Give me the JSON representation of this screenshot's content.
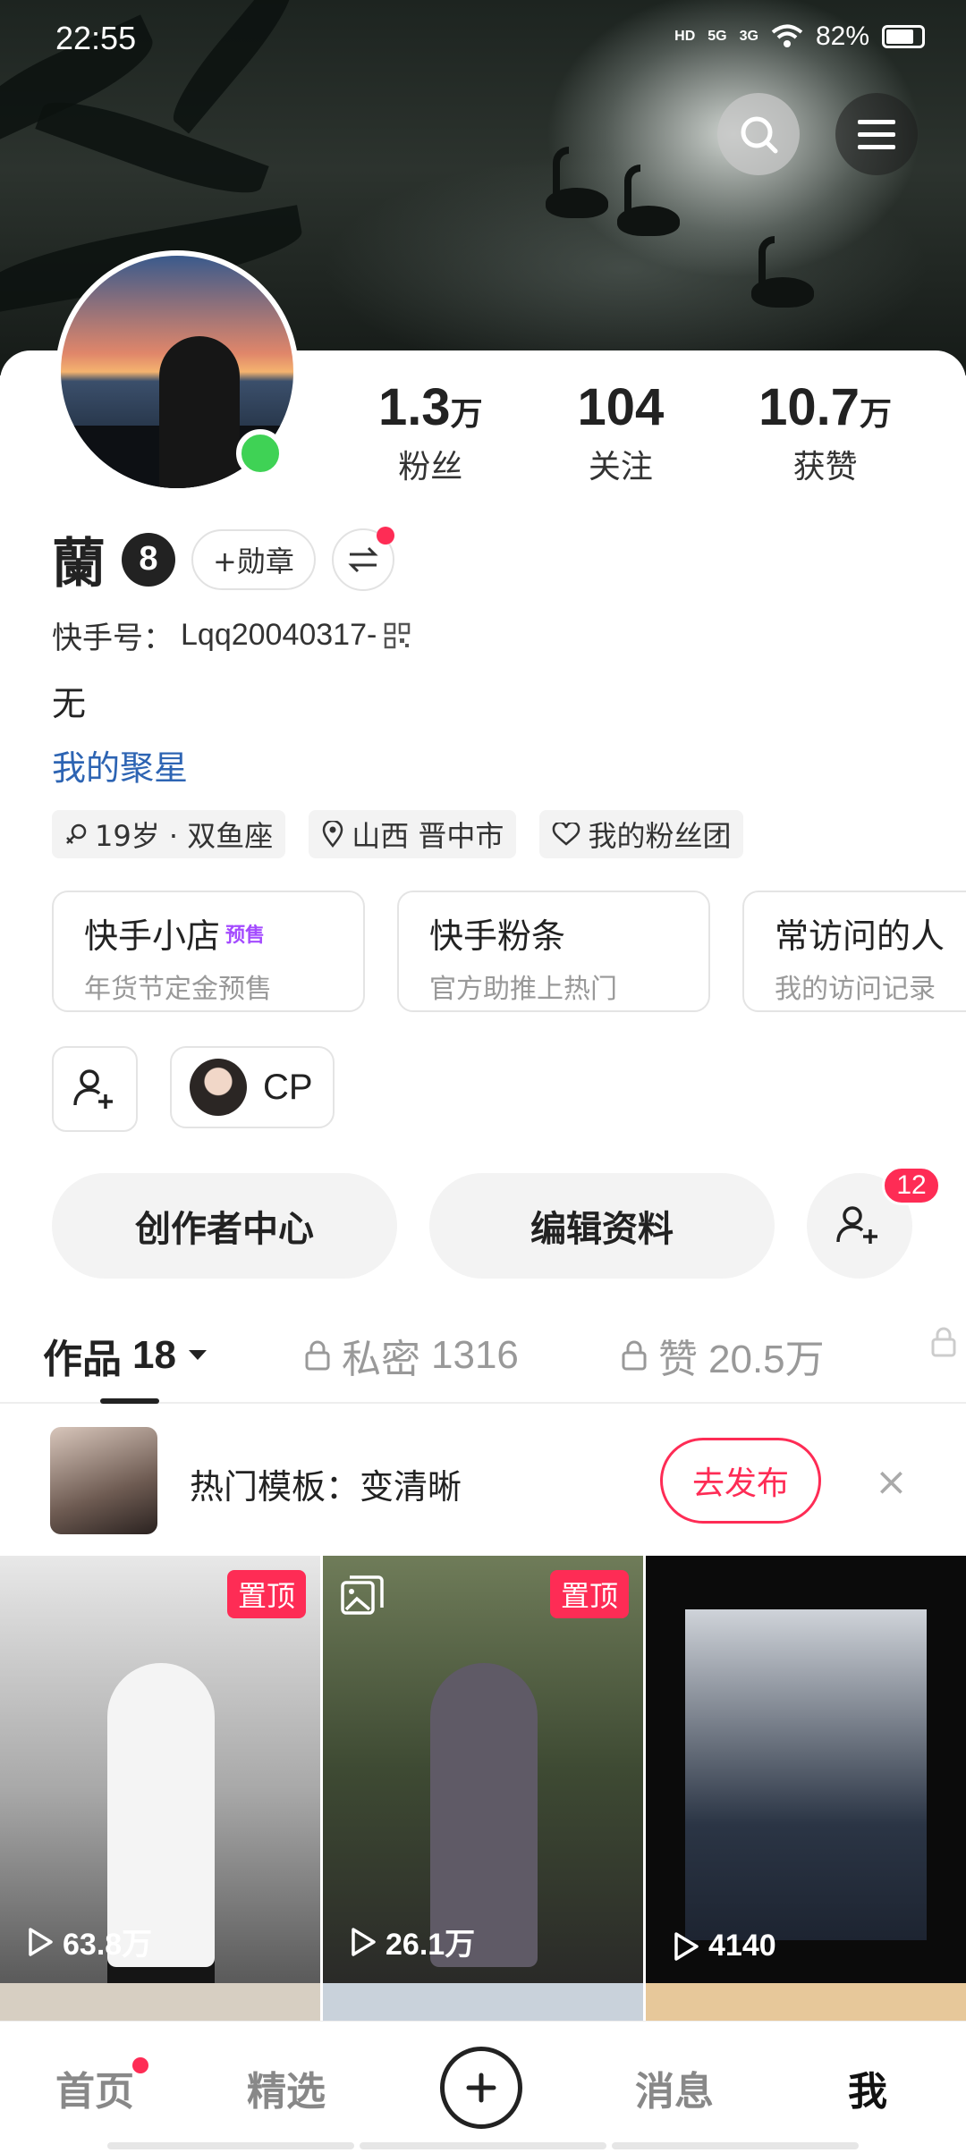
{
  "status": {
    "time": "22:55",
    "hd": "HD",
    "net1": "5G",
    "net2": "3G",
    "battery": "82%"
  },
  "header": {
    "search_icon": "search-icon",
    "menu_icon": "menu-icon"
  },
  "profile": {
    "name": "蘭",
    "level": "8",
    "medal_label": "+勋章",
    "kuaishou_id_label": "快手号：",
    "kuaishou_id": "Lqq20040317-",
    "bio": "无",
    "juxing": "我的聚星",
    "stats": [
      {
        "num": "1.3",
        "unit": "万",
        "label": "粉丝"
      },
      {
        "num": "104",
        "unit": "",
        "label": "关注"
      },
      {
        "num": "10.7",
        "unit": "万",
        "label": "获赞"
      }
    ],
    "tags": [
      "19岁 · 双鱼座",
      "山西 晋中市",
      "我的粉丝团"
    ]
  },
  "tiles": [
    {
      "title": "快手小店",
      "badge": "预售",
      "sub": "年货节定金预售"
    },
    {
      "title": "快手粉条",
      "badge": "",
      "sub": "官方助推上热门"
    },
    {
      "title": "常访问的人",
      "badge": "",
      "sub": "我的访问记录"
    }
  ],
  "cp": {
    "label": "CP"
  },
  "actions": {
    "creator": "创作者中心",
    "edit": "编辑资料",
    "friend_badge": "12"
  },
  "tabs": [
    {
      "label": "作品",
      "count": "18"
    },
    {
      "label": "私密",
      "count": "1316"
    },
    {
      "label": "赞",
      "count": "20.5万"
    }
  ],
  "promo": {
    "text": "热门模板：变清晰",
    "button": "去发布",
    "close": "×"
  },
  "videos": [
    {
      "pinned": "置顶",
      "plays": "63.8万"
    },
    {
      "pinned": "置顶",
      "plays": "26.1万"
    },
    {
      "pinned": "",
      "plays": "4140"
    }
  ],
  "nav": {
    "home": "首页",
    "featured": "精选",
    "messages": "消息",
    "me": "我"
  },
  "colors": {
    "accent": "#fe2c55",
    "link": "#2d64b3",
    "online": "#3fd255"
  }
}
